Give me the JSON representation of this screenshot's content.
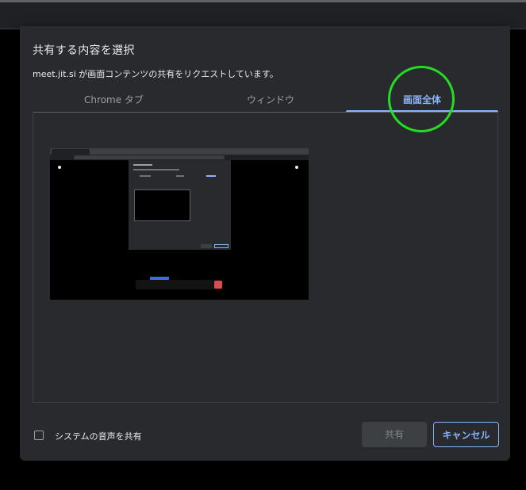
{
  "dialog": {
    "title": "共有する内容を選択",
    "subtitle": "meet.jit.si が画面コンテンツの共有をリクエストしています。"
  },
  "tabs": [
    {
      "label": "Chrome タブ",
      "active": false
    },
    {
      "label": "ウィンドウ",
      "active": false
    },
    {
      "label": "画面全体",
      "active": true
    }
  ],
  "share_audio": {
    "label": "システムの音声を共有",
    "checked": false
  },
  "buttons": {
    "share_label": "共有",
    "cancel_label": "キャンセル"
  },
  "colors": {
    "accent": "#8ab4f8",
    "dialog_bg": "#292a2d",
    "highlight_ring": "#22dd22"
  }
}
